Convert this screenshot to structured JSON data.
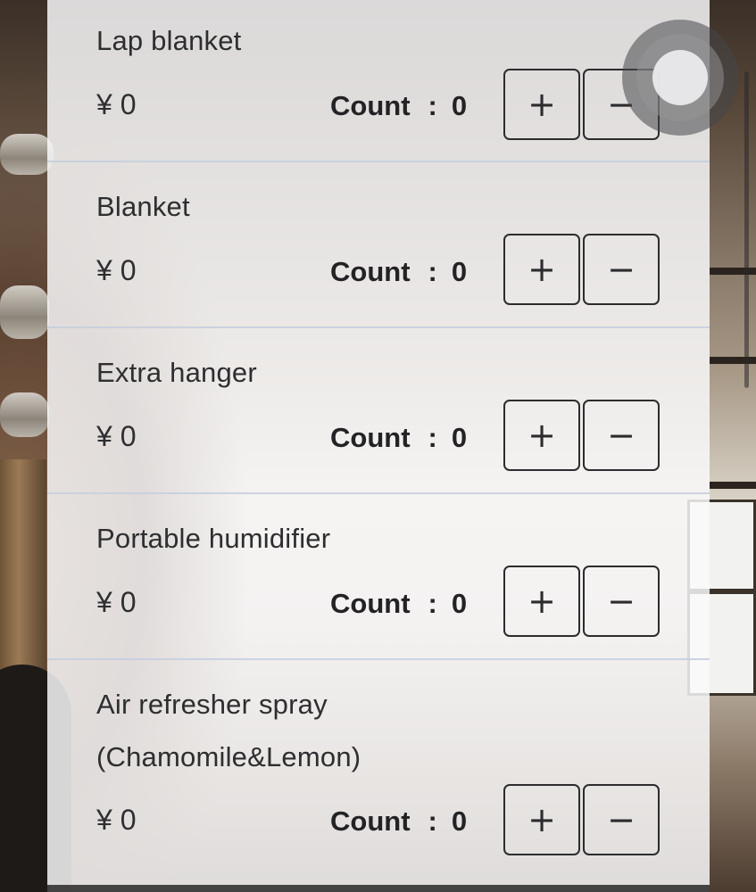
{
  "currency_prefix": "¥",
  "count_label": "Count",
  "count_separator": ":",
  "items": [
    {
      "name": "Lap blanket",
      "price": "¥ 0",
      "count": "0",
      "plus": "+",
      "minus": "−"
    },
    {
      "name": "Blanket",
      "price": "¥ 0",
      "count": "0",
      "plus": "+",
      "minus": "−"
    },
    {
      "name": "Extra hanger",
      "price": "¥ 0",
      "count": "0",
      "plus": "+",
      "minus": "−"
    },
    {
      "name": "Portable humidifier",
      "price": "¥ 0",
      "count": "0",
      "plus": "+",
      "minus": "−"
    },
    {
      "name": "Air refresher spray",
      "name_line2": "(Chamomile&Lemon)",
      "price": "¥ 0",
      "count": "0",
      "plus": "+",
      "minus": "−"
    }
  ]
}
